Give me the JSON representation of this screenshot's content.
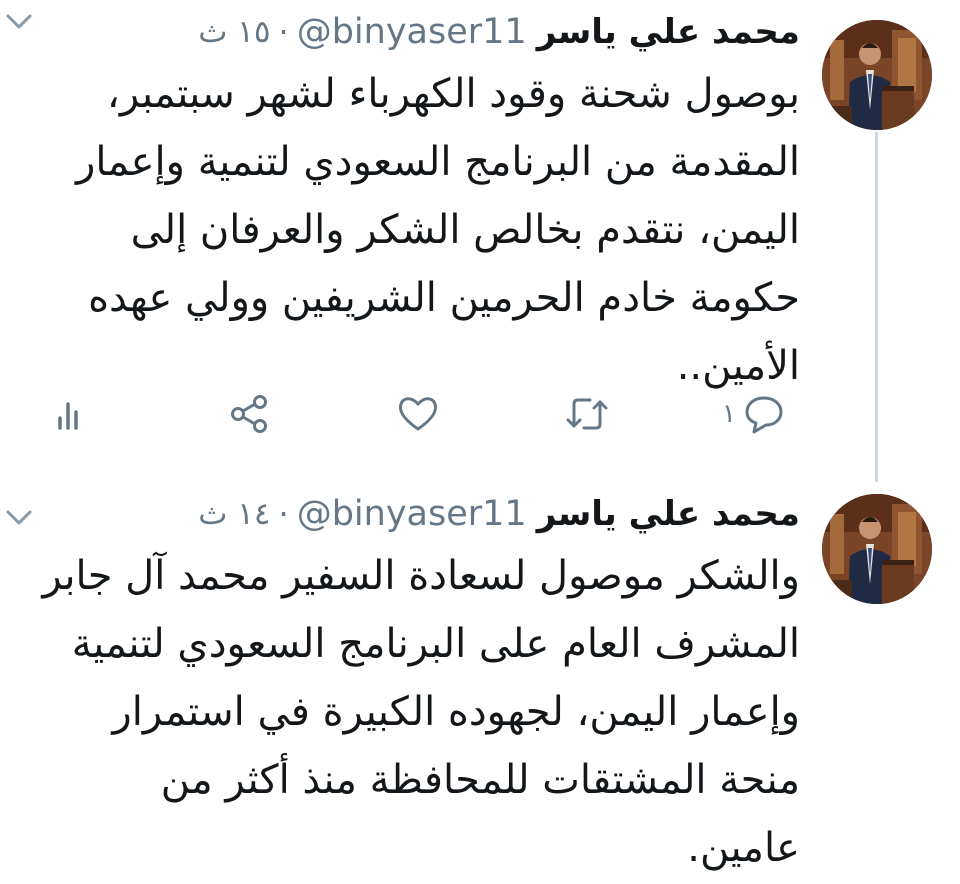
{
  "tweets": [
    {
      "author_name": "محمد علي ياسر",
      "handle": "@binyaser11",
      "separator": "·",
      "time": "١٥ ث",
      "lines": [
        "بوصول شحنة وقود الكهرباء لشهر سبتمبر،",
        "المقدمة من البرنامج السعودي لتنمية وإعمار",
        "اليمن، نتقدم بخالص الشكر والعرفان إلى",
        "حكومة خادم الحرمين الشريفين وولي عهده",
        "الأمين.."
      ],
      "reply_count": "١"
    },
    {
      "author_name": "محمد علي ياسر",
      "handle": "@binyaser11",
      "separator": "·",
      "time": "١٤ ث",
      "lines": [
        "والشكر موصول لسعادة السفير محمد آل جابر",
        "المشرف العام على البرنامج السعودي لتنمية",
        "وإعمار اليمن، لجهوده الكبيرة في استمرار",
        "منحة المشتقات للمحافظة منذ أكثر من",
        "عامين."
      ]
    }
  ],
  "icons": {
    "reply": "reply-icon",
    "retweet": "retweet-icon",
    "like": "heart-icon",
    "share": "share-icon",
    "analytics": "analytics-icon",
    "more": "chevron-down-icon"
  },
  "colors": {
    "text": "#14171a",
    "secondary": "#657786",
    "thread_line": "#ccd6dd"
  }
}
